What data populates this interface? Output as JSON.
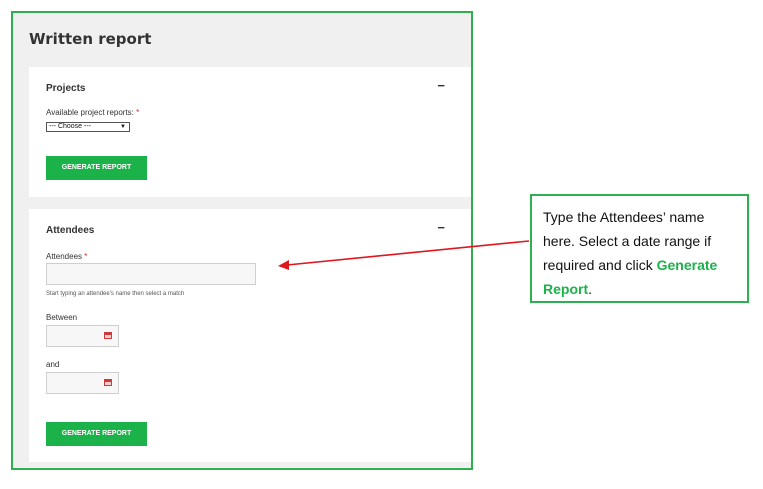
{
  "page_title": "Written report",
  "projects": {
    "title": "Projects",
    "collapse_symbol": "−",
    "label": "Available project reports:",
    "required_mark": "*",
    "select_value": "--- Choose ---",
    "button_label": "GENERATE REPORT"
  },
  "attendees": {
    "title": "Attendees",
    "collapse_symbol": "−",
    "label": "Attendees",
    "required_mark": "*",
    "attendee_value": "",
    "help_text": "Start typing an attendee's name then select a match",
    "between_label": "Between",
    "and_label": "and",
    "button_label": "GENERATE REPORT"
  },
  "callout": {
    "text_before": "Type the Attendees’ name here. Select a date range if required and click ",
    "highlight": "Generate Report",
    "text_after": "."
  },
  "colors": {
    "accent_green": "#1cb24a",
    "frame_green": "#2eb050",
    "arrow_red": "#e0161e",
    "required_red": "#d9242b"
  }
}
